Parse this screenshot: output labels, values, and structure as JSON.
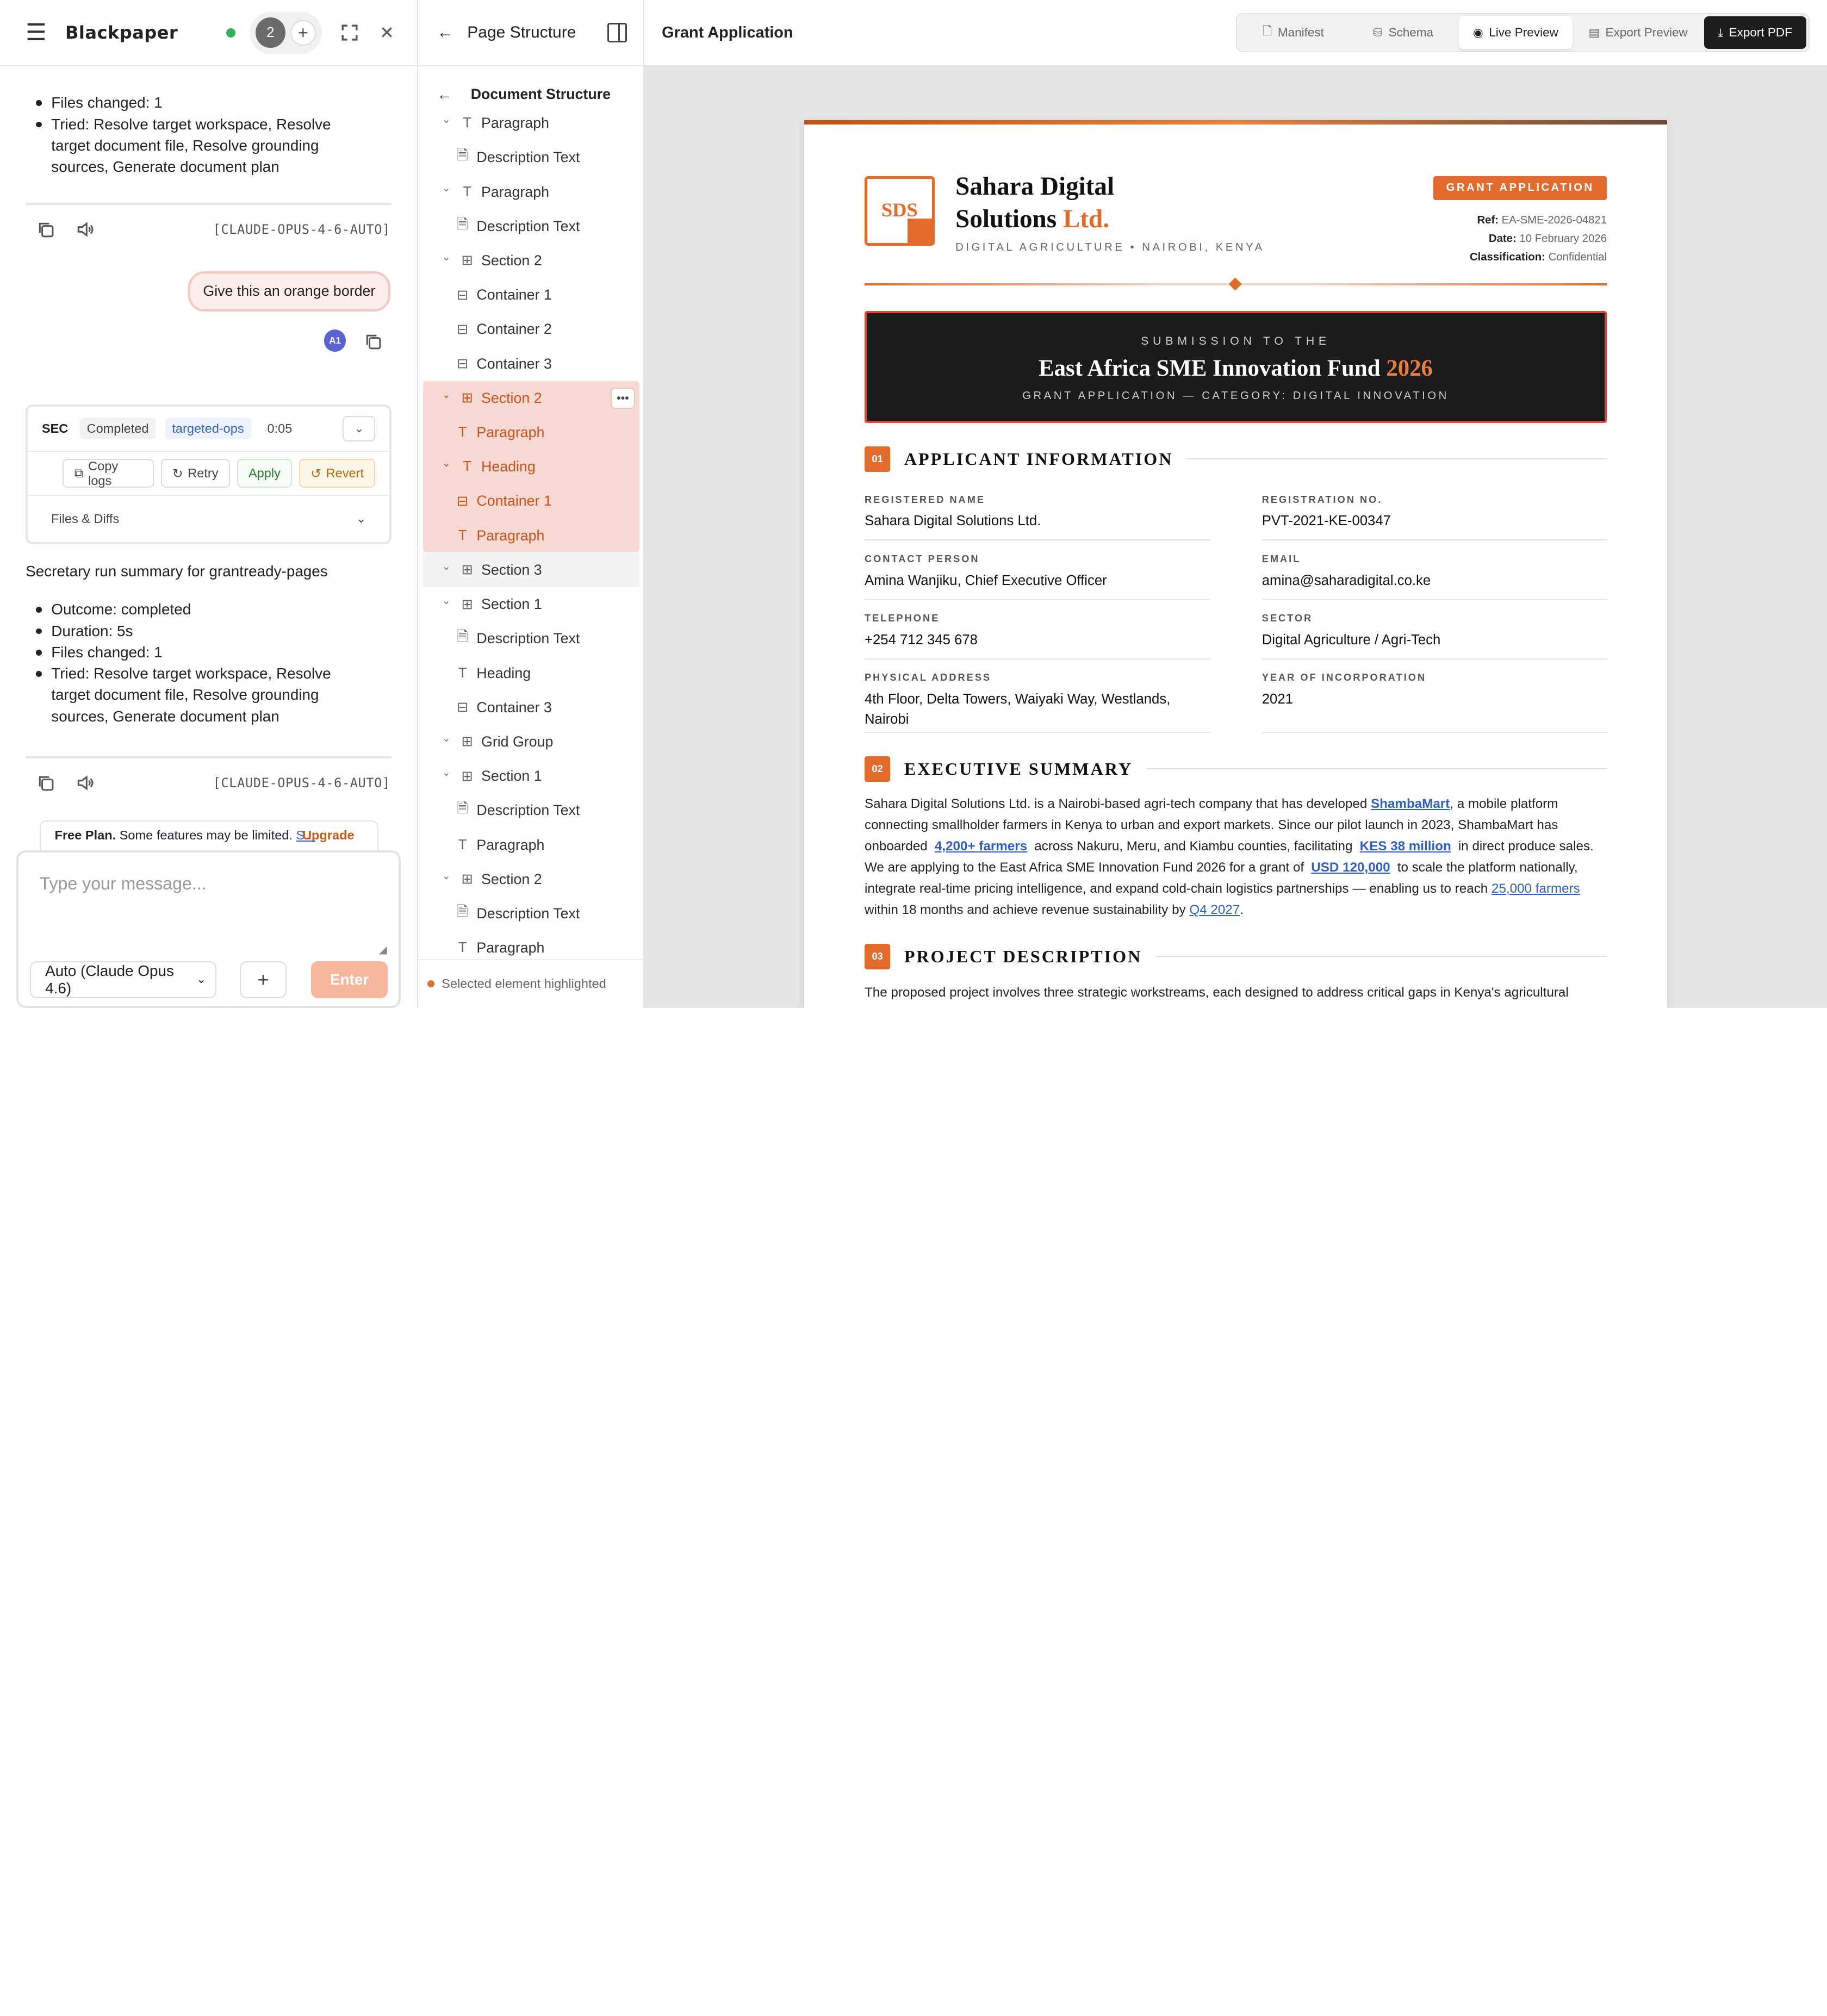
{
  "chat": {
    "brand": "Blackpaper",
    "session_count": "2",
    "summary1_items": [
      "Files changed: 1",
      "Tried: Resolve target workspace, Resolve target document file, Resolve grounding sources, Generate document plan"
    ],
    "model_tag": "[CLAUDE-OPUS-4-6-AUTO]",
    "user_message": "Give this an orange border",
    "avatar": "A1",
    "sec": {
      "title": "SEC",
      "status": "Completed",
      "mode": "targeted-ops",
      "time": "0:05",
      "copy": "Copy logs",
      "retry": "Retry",
      "apply": "Apply",
      "revert": "Revert",
      "files": "Files & Diffs"
    },
    "summary_title": "Secretary run summary for grantready-pages",
    "summary2_items": [
      "Outcome: completed",
      "Duration: 5s",
      "Files changed: 1",
      "Tried: Resolve target workspace, Resolve target document file, Resolve grounding sources, Generate document plan"
    ],
    "plan": {
      "label": "Free Plan.",
      "text": " Some features may be limited. ",
      "link": "S...",
      "upgrade": "Upgrade"
    },
    "composer": {
      "placeholder": "Type your message...",
      "model": "Auto (Claude Opus 4.6)",
      "enter": "Enter"
    }
  },
  "tree": {
    "title": "Page Structure",
    "doc_title": "Document Structure",
    "footer": "Selected element highlighted",
    "rows": [
      {
        "label": "Paragraph",
        "icon": "text-icon",
        "chev": true
      },
      {
        "label": "Description Text",
        "icon": "document-icon",
        "chev": false
      },
      {
        "label": "Paragraph",
        "icon": "text-icon",
        "chev": true
      },
      {
        "label": "Description Text",
        "icon": "document-icon",
        "chev": false
      },
      {
        "label": "Section 2",
        "icon": "grid-icon",
        "chev": true
      },
      {
        "label": "Container 1",
        "icon": "layout-icon",
        "chev": false
      },
      {
        "label": "Container 2",
        "icon": "layout-icon",
        "chev": false
      },
      {
        "label": "Container 3",
        "icon": "layout-icon",
        "chev": false
      },
      {
        "label": "Section 2",
        "icon": "grid-icon",
        "chev": true,
        "sel": true
      },
      {
        "label": "Paragraph",
        "icon": "text-icon",
        "chev": false,
        "sel": true
      },
      {
        "label": "Heading",
        "icon": "text-icon",
        "chev": true,
        "sel": true
      },
      {
        "label": "Container 1",
        "icon": "layout-icon",
        "chev": false,
        "sel": true
      },
      {
        "label": "Paragraph",
        "icon": "text-icon",
        "chev": false,
        "sel": true
      },
      {
        "label": "Section 3",
        "icon": "grid-icon",
        "chev": true,
        "grey": true
      },
      {
        "label": "Section 1",
        "icon": "grid-icon",
        "chev": true
      },
      {
        "label": "Description Text",
        "icon": "document-icon",
        "chev": false
      },
      {
        "label": "Heading",
        "icon": "text-icon",
        "chev": false
      },
      {
        "label": "Container 3",
        "icon": "layout-icon",
        "chev": false
      },
      {
        "label": "Grid Group",
        "icon": "grid-icon",
        "chev": true
      },
      {
        "label": "Section 1",
        "icon": "grid-icon",
        "chev": true
      },
      {
        "label": "Description Text",
        "icon": "document-icon",
        "chev": false
      },
      {
        "label": "Paragraph",
        "icon": "text-icon",
        "chev": false
      },
      {
        "label": "Section 2",
        "icon": "grid-icon",
        "chev": true
      },
      {
        "label": "Description Text",
        "icon": "document-icon",
        "chev": false
      },
      {
        "label": "Paragraph",
        "icon": "text-icon",
        "chev": false
      }
    ]
  },
  "preview": {
    "title": "Grant Application",
    "tabs": [
      "Manifest",
      "Schema",
      "Live Preview",
      "Export Preview",
      "Export PDF"
    ],
    "active_tab": "Live Preview"
  },
  "doc": {
    "logo": "SDS",
    "name_line1": "Sahara Digital",
    "name_line2a": "Solutions ",
    "name_line2b": "Ltd.",
    "tagline": "DIGITAL AGRICULTURE • NAIROBI, KENYA",
    "badge": "GRANT APPLICATION",
    "ref_label": "Ref:",
    "ref": "EA-SME-2026-04821",
    "date_label": "Date:",
    "date": "10 February 2026",
    "class_label": "Classification:",
    "class": "Confidential",
    "banner_top": "SUBMISSION TO THE",
    "banner_title": "East Africa SME Innovation Fund ",
    "banner_year": "2026",
    "banner_sub": "GRANT APPLICATION — CATEGORY: DIGITAL INNOVATION",
    "s1_num": "01",
    "s1_title": "APPLICANT INFORMATION",
    "fields": [
      {
        "label": "REGISTERED NAME",
        "value": "Sahara Digital Solutions Ltd."
      },
      {
        "label": "REGISTRATION NO.",
        "value": "PVT-2021-KE-00347"
      },
      {
        "label": "CONTACT PERSON",
        "value": "Amina Wanjiku, Chief Executive Officer"
      },
      {
        "label": "EMAIL",
        "value": "amina@saharadigital.co.ke"
      },
      {
        "label": "TELEPHONE",
        "value": "+254 712 345 678"
      },
      {
        "label": "SECTOR",
        "value": "Digital Agriculture / Agri-Tech"
      },
      {
        "label": "PHYSICAL ADDRESS",
        "value": "4th Floor, Delta Towers, Waiyaki Way, Westlands, Nairobi"
      },
      {
        "label": "YEAR OF INCORPORATION",
        "value": "2021"
      }
    ],
    "s2_num": "02",
    "s2_title": "EXECUTIVE SUMMARY",
    "exec": {
      "t1": "Sahara Digital Solutions Ltd. is a Nairobi-based agri-tech company that has developed ",
      "k1": "ShambaMart",
      "t2": ", a mobile platform connecting smallholder farmers in Kenya to urban and export markets. Since our pilot launch in 2023, ShambaMart has onboarded ",
      "k2": "4,200+ farmers",
      "t3": " across Nakuru, Meru, and Kiambu counties, facilitating ",
      "k3": "KES 38 million",
      "t4": " in direct produce sales. We are applying to the East Africa SME Innovation Fund 2026 for a grant of ",
      "k4": "USD 120,000",
      "t5": " to scale the platform nationally, integrate real-time pricing intelligence, and expand cold-chain logistics partnerships — enabling us to reach ",
      "k5": "25,000 farmers",
      "t6": " within 18 months and achieve revenue sustainability by ",
      "k6": "Q4 2027",
      "t7": "."
    },
    "s3_num": "03",
    "s3_title": "PROJECT DESCRIPTION",
    "proj": "The proposed project involves three strategic workstreams, each designed to address critical gaps in Kenya's agricultural"
  }
}
